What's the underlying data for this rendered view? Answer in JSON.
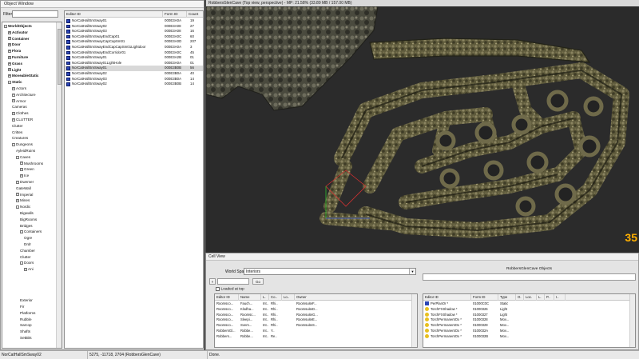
{
  "object_window": {
    "title": "Object Window",
    "filter_label": "Filter",
    "filter_value": "",
    "tree": [
      {
        "label": "WorldObjects",
        "level": 0,
        "bold": true,
        "exp": "-"
      },
      {
        "label": "Activator",
        "level": 1,
        "bold": true,
        "exp": "+"
      },
      {
        "label": "Container",
        "level": 1,
        "bold": true,
        "exp": "+"
      },
      {
        "label": "Door",
        "level": 1,
        "bold": true,
        "exp": "+"
      },
      {
        "label": "Flora",
        "level": 1,
        "bold": true,
        "exp": "+"
      },
      {
        "label": "Furniture",
        "level": 1,
        "bold": true,
        "exp": "+"
      },
      {
        "label": "Grass",
        "level": 1,
        "bold": true,
        "exp": "+"
      },
      {
        "label": "Light",
        "level": 1,
        "bold": true,
        "exp": "+"
      },
      {
        "label": "MoveableStatic",
        "level": 1,
        "bold": true,
        "exp": "+"
      },
      {
        "label": "Static",
        "level": 1,
        "bold": true,
        "exp": "-"
      },
      {
        "label": "Actors",
        "level": 2,
        "bold": false,
        "exp": "+"
      },
      {
        "label": "Architecture",
        "level": 2,
        "bold": false,
        "exp": "+"
      },
      {
        "label": "Armor",
        "level": 2,
        "bold": false,
        "exp": "+"
      },
      {
        "label": "Cameras",
        "level": 2,
        "bold": false,
        "exp": ""
      },
      {
        "label": "Clothes",
        "level": 2,
        "bold": false,
        "exp": "+"
      },
      {
        "label": "CLUTTER",
        "level": 2,
        "bold": false,
        "exp": "+"
      },
      {
        "label": "Clutter",
        "level": 2,
        "bold": false,
        "exp": ""
      },
      {
        "label": "Crittes",
        "level": 2,
        "bold": false,
        "exp": ""
      },
      {
        "label": "Creatures",
        "level": 2,
        "bold": false,
        "exp": ""
      },
      {
        "label": "Dungeons",
        "level": 2,
        "bold": false,
        "exp": "-"
      },
      {
        "label": "AyleidRuins",
        "level": 3,
        "bold": false,
        "exp": ""
      },
      {
        "label": "Caves",
        "level": 3,
        "bold": false,
        "exp": "-"
      },
      {
        "label": "Mushrooms",
        "level": 4,
        "bold": false,
        "exp": "+"
      },
      {
        "label": "Green",
        "level": 4,
        "bold": false,
        "exp": "+"
      },
      {
        "label": "Ice",
        "level": 4,
        "bold": false,
        "exp": "+"
      },
      {
        "label": "Dwemer",
        "level": 3,
        "bold": false,
        "exp": "+"
      },
      {
        "label": "GateWall",
        "level": 3,
        "bold": false,
        "exp": ""
      },
      {
        "label": "Imperial",
        "level": 3,
        "bold": false,
        "exp": "+"
      },
      {
        "label": "Mines",
        "level": 3,
        "bold": false,
        "exp": "+"
      },
      {
        "label": "Nordic",
        "level": 3,
        "bold": false,
        "exp": "-"
      },
      {
        "label": "Bigwalls",
        "level": 4,
        "bold": false,
        "exp": ""
      },
      {
        "label": "BigRooms",
        "level": 4,
        "bold": false,
        "exp": ""
      },
      {
        "label": "Bridges",
        "level": 4,
        "bold": false,
        "exp": ""
      },
      {
        "label": "Containers",
        "level": 4,
        "bold": false,
        "exp": "-"
      },
      {
        "label": "Ogre",
        "level": 5,
        "bold": false,
        "exp": ""
      },
      {
        "label": "Drdr",
        "level": 5,
        "bold": false,
        "exp": ""
      },
      {
        "label": "Chamber",
        "level": 4,
        "bold": false,
        "exp": ""
      },
      {
        "label": "Clutter",
        "level": 4,
        "bold": false,
        "exp": ""
      },
      {
        "label": "Doors",
        "level": 4,
        "bold": false,
        "exp": "-"
      },
      {
        "label": "Ani",
        "level": 5,
        "bold": false,
        "exp": "+"
      },
      {
        "label": "",
        "level": 6,
        "bold": false,
        "exp": ""
      },
      {
        "label": "",
        "level": 6,
        "bold": false,
        "exp": ""
      },
      {
        "label": "",
        "level": 6,
        "bold": false,
        "exp": ""
      },
      {
        "label": "",
        "level": 6,
        "bold": false,
        "exp": ""
      },
      {
        "label": "Exterior",
        "level": 4,
        "bold": false,
        "exp": ""
      },
      {
        "label": "Fir",
        "level": 4,
        "bold": false,
        "exp": ""
      },
      {
        "label": "Platforms",
        "level": 4,
        "bold": false,
        "exp": ""
      },
      {
        "label": "Rubble",
        "level": 4,
        "bold": false,
        "exp": ""
      },
      {
        "label": "Sarcop",
        "level": 4,
        "bold": false,
        "exp": ""
      },
      {
        "label": "Shafts",
        "level": 4,
        "bold": false,
        "exp": ""
      },
      {
        "label": "SetBits",
        "level": 4,
        "bold": false,
        "exp": ""
      },
      {
        "label": "",
        "level": 4,
        "bold": false,
        "exp": ""
      }
    ],
    "columns": [
      "Editor ID",
      "Form ID",
      "Count"
    ],
    "rows": [
      {
        "id": "NorCatHallSmSway01",
        "form": "000E3A0A",
        "count": "19",
        "sel": false
      },
      {
        "id": "NorCatHallSmSway02",
        "form": "000E3A08",
        "count": "27",
        "sel": false
      },
      {
        "id": "NorCatHallSmSway03",
        "form": "000E3A08",
        "count": "16",
        "sel": false
      },
      {
        "id": "NorCatHallSmSwayEndCap01",
        "form": "000E3A0C",
        "count": "60",
        "sel": false
      },
      {
        "id": "NorCatHallSmSwayCapCapSm01",
        "form": "000E3A0D",
        "count": "207",
        "sel": false
      },
      {
        "id": "NorCatHallSmSwayEndCapCapSm01Lightdoor",
        "form": "000E3A0A",
        "count": "3",
        "sel": false
      },
      {
        "id": "NorCatHallSmSwayEndCorridor01",
        "form": "000E3A0C",
        "count": "45",
        "sel": false
      },
      {
        "id": "NorCatHallSmSway01",
        "form": "000E3A2B",
        "count": "01",
        "sel": false
      },
      {
        "id": "NorCatHallSmSway01LightHole",
        "form": "000E3A0A",
        "count": "01",
        "sel": false
      },
      {
        "id": "NorCatHallSmSway01",
        "form": "000E3B0B",
        "count": "56",
        "sel": true
      },
      {
        "id": "NorCatHallSmSway02",
        "form": "000E3B0A",
        "count": "40",
        "sel": false
      },
      {
        "id": "NorCatHallSmSway03",
        "form": "000E3B0A",
        "count": "14",
        "sel": false
      },
      {
        "id": "NorCatHallSmSway02",
        "form": "000E3B0B",
        "count": "14",
        "sel": false
      }
    ]
  },
  "render_window": {
    "title": "RobbersGlenCave (Top view, perspective) - MP: 21.58% (33.89 MB / 157.00 MB)",
    "fps": "35"
  },
  "cell_view": {
    "title": "Cell View",
    "world_space_label": "World Space",
    "world_space_value": "Interiors",
    "x_input": "",
    "go_button": "Go",
    "loaded_label": "Loaded at top",
    "objects_title": "RobbersGlenCave Objects",
    "cells_columns": [
      "Editor ID",
      "Name",
      "L.",
      "Co..",
      "Lo..",
      "Owner"
    ],
    "cells_rows": [
      [
        "Roomsco...",
        "Fauch...",
        "Int..",
        "Rhi..",
        "RoomsuiteF..."
      ],
      [
        "Roomsco...",
        "Klodha...",
        "Int..",
        "Rhi..",
        "RoomsuiteD..."
      ],
      [
        "Roomsco...",
        "Roomsc...",
        "Int..",
        "Rhi..",
        "RoomsuiteG..."
      ],
      [
        "Roomsco...",
        "Sleepi...",
        "Int..",
        "Rhi..",
        "RoomsuiteE..."
      ],
      [
        "Roomsco...",
        "Svers...",
        "Int..",
        "Rhi..",
        "RoomsuiteS..."
      ],
      [
        "RobbersGl...",
        "Robbe...",
        "Int..",
        "Y..",
        ""
      ],
      [
        "Robbers...",
        "Robbe...",
        "Int..",
        "Re..",
        ""
      ]
    ],
    "objects_columns": [
      "Editor ID",
      "Form ID",
      "Type",
      "O.",
      "Loc.",
      "L.",
      "P..",
      "I.."
    ],
    "objects_rows": [
      [
        "PerPlanOr *",
        "01000C0C",
        "Static",
        "",
        "",
        "",
        "",
        ""
      ],
      [
        "TorchFXShadow *",
        "01000326",
        "Light",
        "",
        "",
        "",
        "",
        ""
      ],
      [
        "TorchFXShadow *",
        "01000327",
        "Light",
        "",
        "",
        "",
        "",
        ""
      ],
      [
        "TorchPermanentOx *",
        "01000328",
        "Mov...",
        "",
        "",
        "",
        "",
        ""
      ],
      [
        "TorchPermanentOx *",
        "01000329",
        "Mov...",
        "",
        "",
        "",
        "",
        ""
      ],
      [
        "TorchPermanentOx *",
        "0100032A",
        "Mov...",
        "",
        "",
        "",
        "",
        ""
      ],
      [
        "TorchPermanentOx *",
        "0100032B",
        "Mov...",
        "",
        "",
        "",
        "",
        ""
      ]
    ]
  },
  "status_bar": {
    "object": "NorCatHallSmSway02",
    "coords": "5275, -11718, 2704 (RobbersGlenCave)",
    "state": "Done."
  },
  "colors": {
    "fps": "#ffb000",
    "stone": "#6f6a4a",
    "viewport_bg": "#2b2b2b"
  }
}
